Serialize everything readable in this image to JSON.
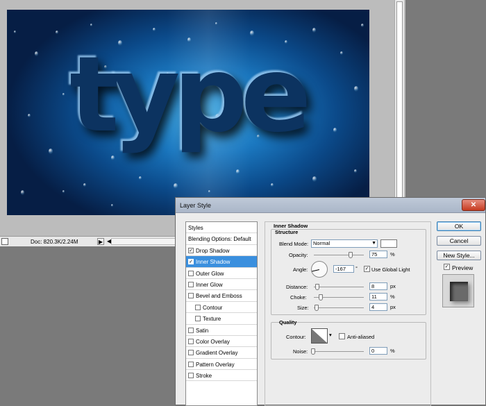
{
  "canvas": {
    "text": "type"
  },
  "status": {
    "doc": "Doc: 820.3K/2.24M",
    "arrow": "▶",
    "arrow2": "◀"
  },
  "dialog": {
    "title": "Layer Style",
    "close": "✕",
    "styles_header": "Styles",
    "blending_options": "Blending Options: Default",
    "styles": [
      {
        "label": "Drop Shadow",
        "checked": true
      },
      {
        "label": "Inner Shadow",
        "checked": true,
        "selected": true
      },
      {
        "label": "Outer Glow",
        "checked": false
      },
      {
        "label": "Inner Glow",
        "checked": false
      },
      {
        "label": "Bevel and Emboss",
        "checked": false
      },
      {
        "label": "Contour",
        "checked": false,
        "sub": true
      },
      {
        "label": "Texture",
        "checked": false,
        "sub": true
      },
      {
        "label": "Satin",
        "checked": false
      },
      {
        "label": "Color Overlay",
        "checked": false
      },
      {
        "label": "Gradient Overlay",
        "checked": false
      },
      {
        "label": "Pattern Overlay",
        "checked": false
      },
      {
        "label": "Stroke",
        "checked": false
      }
    ],
    "section_title": "Inner Shadow",
    "structure": {
      "title": "Structure",
      "blend_mode_label": "Blend Mode:",
      "blend_mode_value": "Normal",
      "opacity_label": "Opacity:",
      "opacity_value": "75",
      "opacity_unit": "%",
      "angle_label": "Angle:",
      "angle_value": "-167",
      "angle_unit": "°",
      "use_global_light": "Use Global Light",
      "distance_label": "Distance:",
      "distance_value": "8",
      "distance_unit": "px",
      "choke_label": "Choke:",
      "choke_value": "11",
      "choke_unit": "%",
      "size_label": "Size:",
      "size_value": "4",
      "size_unit": "px",
      "sliders": {
        "opacity": 0.75,
        "distance": 0.03,
        "choke": 0.11,
        "size": 0.02
      }
    },
    "quality": {
      "title": "Quality",
      "contour_label": "Contour:",
      "anti_aliased": "Anti-aliased",
      "noise_label": "Noise:",
      "noise_value": "0",
      "noise_unit": "%",
      "noise_slider": 0
    },
    "buttons": {
      "ok": "OK",
      "cancel": "Cancel",
      "new_style": "New Style...",
      "preview": "Preview"
    },
    "shadow_color": "#ffffff",
    "selection_color": "#3a8fde"
  }
}
